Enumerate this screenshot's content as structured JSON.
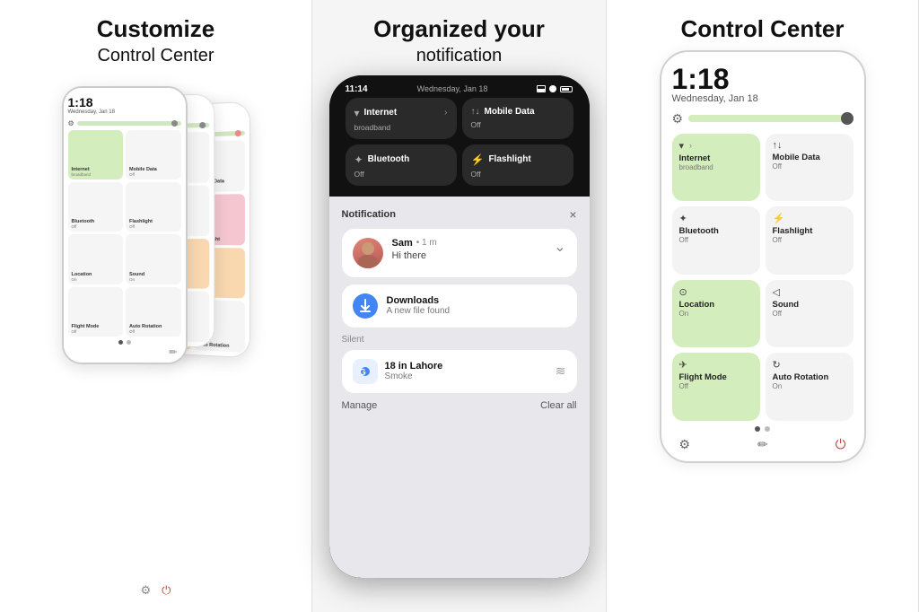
{
  "panel1": {
    "title": "Customize",
    "subtitle": "Control Center",
    "phone": {
      "time": "1:18",
      "date": "Wednesday, Jan 18",
      "tiles": [
        {
          "label": "Internet",
          "sub": "broadband",
          "color": "green"
        },
        {
          "label": "Mobile Data",
          "sub": "Off",
          "color": "white"
        },
        {
          "label": "Bluetooth",
          "sub": "Off",
          "color": "white"
        },
        {
          "label": "Flashlight",
          "sub": "Off",
          "color": "white"
        },
        {
          "label": "Location",
          "sub": "On",
          "color": "white"
        },
        {
          "label": "Sound",
          "sub": "On",
          "color": "white"
        },
        {
          "label": "Flight Mode",
          "sub": "Off",
          "color": "white"
        },
        {
          "label": "Auto Rotation",
          "sub": "Off",
          "color": "white"
        }
      ]
    }
  },
  "panel2": {
    "title": "Organized your",
    "subtitle": "notification",
    "phone": {
      "statusTime": "11:14",
      "statusDate": "Wednesday, Jan 18",
      "tiles": [
        {
          "icon": "wifi",
          "label": "Internet",
          "sub": "broadband",
          "hasArrow": true
        },
        {
          "icon": "signal",
          "label": "Mobile Data",
          "sub": "Off",
          "hasArrow": false
        },
        {
          "icon": "bluetooth",
          "label": "Bluetooth",
          "sub": "Off",
          "hasArrow": false
        },
        {
          "icon": "flashlight",
          "label": "Flashlight",
          "sub": "Off",
          "hasArrow": false
        }
      ],
      "notification": {
        "header": "Notification",
        "sam": {
          "name": "Sam",
          "timeAgo": "• 1 m",
          "message": "Hi there"
        },
        "downloads": {
          "appName": "Downloads",
          "message": "A new file found"
        },
        "divider": "Silent",
        "weather": {
          "title": "18 in Lahore",
          "sub": "Smoke"
        },
        "manage": "Manage",
        "clearAll": "Clear all"
      }
    }
  },
  "panel3": {
    "title": "Control Center",
    "phone": {
      "time": "1:18",
      "date": "Wednesday, Jan 18",
      "tiles": [
        {
          "icon": "wifi",
          "label": "Internet",
          "sub": "broadband",
          "color": "green",
          "hasArrow": true
        },
        {
          "icon": "signal",
          "label": "Mobile Data",
          "sub": "Off",
          "color": "white"
        },
        {
          "icon": "bluetooth",
          "label": "Bluetooth",
          "sub": "Off",
          "color": "white"
        },
        {
          "icon": "flashlight",
          "label": "Flashlight",
          "sub": "Off",
          "color": "white"
        },
        {
          "icon": "location",
          "label": "Location",
          "sub": "On",
          "color": "green"
        },
        {
          "icon": "sound",
          "label": "Sound",
          "sub": "Off",
          "color": "white"
        },
        {
          "icon": "flight",
          "label": "Flight Mode",
          "sub": "Off",
          "color": "green"
        },
        {
          "icon": "rotation",
          "label": "Auto Rotation",
          "sub": "On",
          "color": "white"
        }
      ]
    }
  },
  "icons": {
    "gear": "⚙",
    "wifi": "▾",
    "signal": "↑↓",
    "bluetooth": "✦",
    "flashlight": "⚡",
    "location": "⊙",
    "sound": "◁",
    "flight": "✈",
    "rotation": "↻",
    "edit": "✏",
    "power": "⏻",
    "close": "×",
    "expand": "⌄",
    "waves": "≋",
    "google": "G"
  }
}
